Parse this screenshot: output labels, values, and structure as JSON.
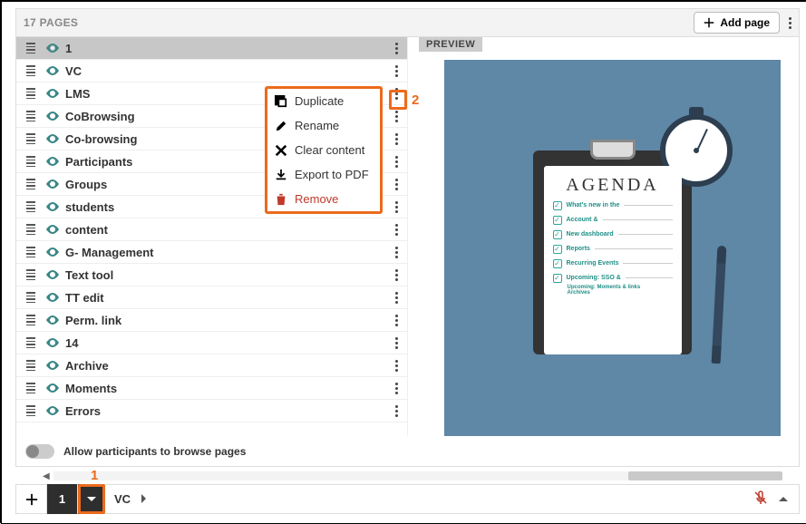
{
  "header": {
    "page_count_label": "17 PAGES",
    "add_page_label": "Add page"
  },
  "pages": [
    {
      "label": "1",
      "active": true
    },
    {
      "label": "VC"
    },
    {
      "label": "LMS"
    },
    {
      "label": "CoBrowsing"
    },
    {
      "label": "Co-browsing"
    },
    {
      "label": "Participants"
    },
    {
      "label": "Groups"
    },
    {
      "label": "students"
    },
    {
      "label": "content"
    },
    {
      "label": "G- Management"
    },
    {
      "label": "Text tool"
    },
    {
      "label": "TT edit"
    },
    {
      "label": "Perm. link"
    },
    {
      "label": "14"
    },
    {
      "label": "Archive"
    },
    {
      "label": "Moments"
    },
    {
      "label": "Errors"
    }
  ],
  "context_menu": {
    "duplicate": "Duplicate",
    "rename": "Rename",
    "clear": "Clear content",
    "export": "Export to PDF",
    "remove": "Remove"
  },
  "callouts": {
    "one": "1",
    "two": "2"
  },
  "preview": {
    "badge": "PREVIEW",
    "agenda_title": "AGENDA",
    "items": [
      "What's new in the",
      "Account &",
      "New dashboard",
      "Reports",
      "Recurring Events",
      "Upcoming: SSO &"
    ],
    "sub1": "Upcoming: Moments & links",
    "sub2": "Archives"
  },
  "footer": {
    "toggle_label": "Allow participants to browse pages"
  },
  "bottom_bar": {
    "page_num": "1",
    "page_name": "VC"
  }
}
